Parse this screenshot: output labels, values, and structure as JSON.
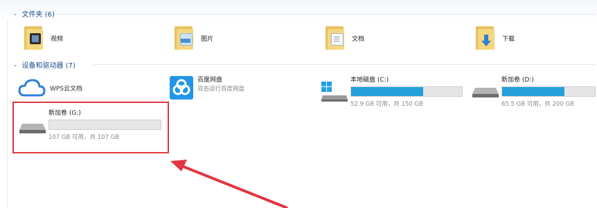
{
  "sections": {
    "folders": {
      "header": "文件夹 (6)"
    },
    "devices": {
      "header": "设备和驱动器 (7)"
    }
  },
  "folders": [
    {
      "label": "视频",
      "icon": "video-folder-icon",
      "badge_color": "#2e2e2e"
    },
    {
      "label": "图片",
      "icon": "pictures-folder-icon",
      "badge_color": "#5aa0d8"
    },
    {
      "label": "文档",
      "icon": "documents-folder-icon",
      "badge_color": "#e8eef6"
    },
    {
      "label": "下载",
      "icon": "downloads-folder-icon",
      "badge_color": "#2f7fd4"
    }
  ],
  "devices": {
    "wps": {
      "label": "WPS云文档",
      "icon": "cloud-icon"
    },
    "baidu": {
      "label": "百度网盘",
      "sub": "双击运行百度网盘",
      "icon": "baidu-netdisk-icon"
    },
    "drive_c": {
      "label": "本地磁盘 (C:)",
      "info": "52.9 GB 可用，共 150 GB",
      "used_fraction": 0.65,
      "icon": "windows-drive-icon"
    },
    "drive_d": {
      "label": "新加卷 (D:)",
      "info": "65.5 GB 可用，共 200 GB",
      "used_fraction": 0.67,
      "icon": "hard-drive-icon"
    },
    "drive_g": {
      "label": "新加卷 (G:)",
      "info": "107 GB 可用，共 107 GB",
      "used_fraction": 0.0,
      "icon": "hard-drive-icon"
    }
  },
  "colors": {
    "accent_bar": "#26a0da",
    "highlight": "#e0363f",
    "header_text": "#1e4e8c"
  }
}
